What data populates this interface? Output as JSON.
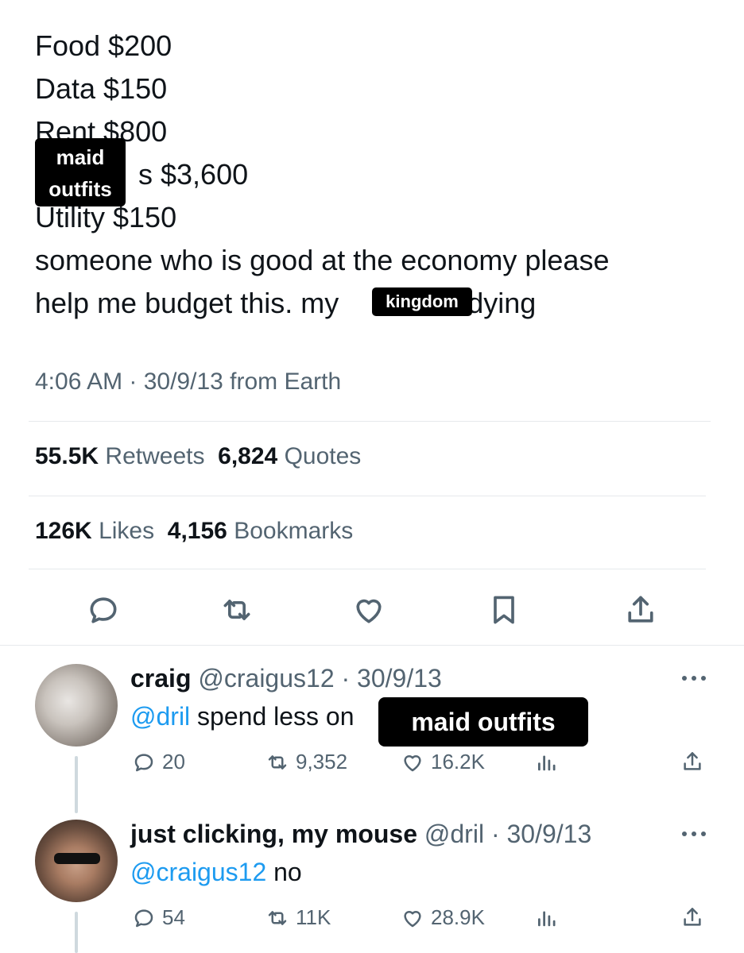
{
  "tweet": {
    "lines": [
      "Food $200",
      "Data $150",
      "Rent $800",
      "s $3,600",
      "Utility $150",
      "someone who is good at the economy please",
      "help me budget this. my"
    ],
    "line7_tail": "s dying",
    "stickers": {
      "top_left": [
        "maid",
        "outfits"
      ],
      "inline": "kingdom"
    },
    "meta": "4:06 AM · 30/9/13 from Earth",
    "stats": {
      "retweets_count": "55.5K",
      "retweets_label": "Retweets",
      "quotes_count": "6,824",
      "quotes_label": "Quotes",
      "likes_count": "126K",
      "likes_label": "Likes",
      "bookmarks_count": "4,156",
      "bookmarks_label": "Bookmarks"
    },
    "action_icons": [
      "reply-icon",
      "retweet-icon",
      "heart-icon",
      "bookmark-icon",
      "share-icon"
    ]
  },
  "replies": [
    {
      "name": "craig",
      "handle": "@craigus12",
      "date": "· 30/9/13",
      "mention": "@dril",
      "text": " spend less on",
      "sticker": "maid outfits",
      "replies": "20",
      "retweets": "9,352",
      "likes": "16.2K"
    },
    {
      "name": "just clicking, my mouse",
      "handle": "@dril",
      "date": "· 30/9/13",
      "mention": "@craigus12",
      "text": " no",
      "replies": "54",
      "retweets": "11K",
      "likes": "28.9K"
    }
  ],
  "colors": {
    "text": "#0f1419",
    "secondary": "#536471",
    "link": "#1d9bf0",
    "divider": "#e6e9ec",
    "sticker_bg": "#000000"
  }
}
